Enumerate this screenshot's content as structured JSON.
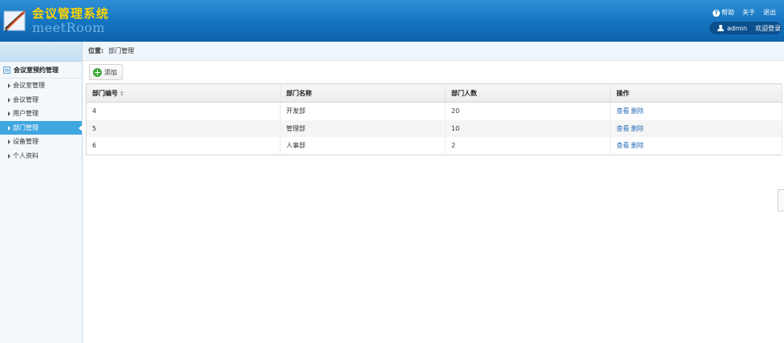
{
  "header": {
    "title": "会议管理系统",
    "subtitle": "meetRoom",
    "links": {
      "help": "帮助",
      "about": "关于",
      "logout": "退出"
    },
    "user": {
      "name": "admin",
      "welcome": "欢迎登录"
    }
  },
  "sidebar": {
    "section": "会议室预约管理",
    "items": [
      {
        "label": "会议室管理",
        "active": false
      },
      {
        "label": "会议管理",
        "active": false
      },
      {
        "label": "用户管理",
        "active": false
      },
      {
        "label": "部门管理",
        "active": true
      },
      {
        "label": "设备管理",
        "active": false
      },
      {
        "label": "个人资料",
        "active": false
      }
    ]
  },
  "breadcrumb": {
    "label": "位置:",
    "current": "部门管理"
  },
  "toolbar": {
    "add_label": "添加"
  },
  "table": {
    "columns": [
      "部门编号",
      "部门名称",
      "部门人数",
      "操作"
    ],
    "rows": [
      {
        "id": "4",
        "name": "开发部",
        "count": "20",
        "view": "查看",
        "delete": "删除"
      },
      {
        "id": "5",
        "name": "管理部",
        "count": "10",
        "view": "查看",
        "delete": "删除"
      },
      {
        "id": "6",
        "name": "人事部",
        "count": "2",
        "view": "查看",
        "delete": "删除"
      }
    ]
  },
  "colors": {
    "header": "#1473bf",
    "title": "#ffd400",
    "active": "#3fa6e0",
    "link": "#2a6fb9"
  }
}
